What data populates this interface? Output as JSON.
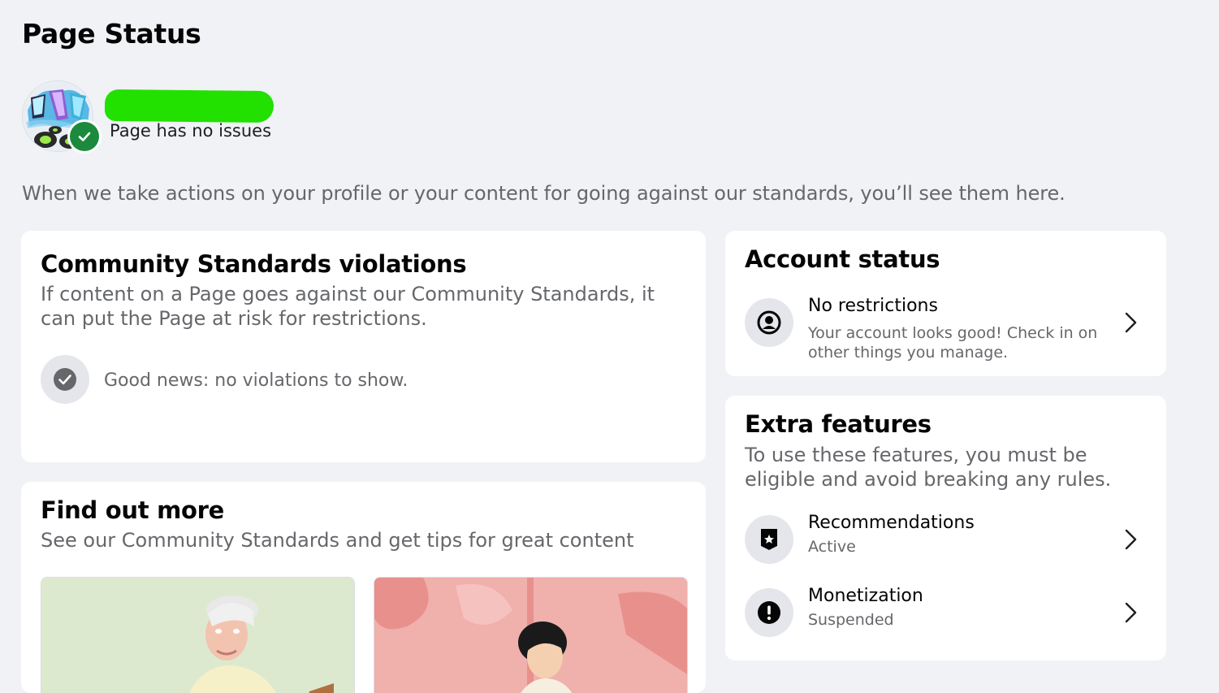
{
  "header": {
    "title": "Page Status"
  },
  "profile": {
    "status_text": "Page has no issues"
  },
  "description": "When we take actions on your profile or your content for going against our standards, you’ll see them here.",
  "community_standards": {
    "title": "Community Standards violations",
    "subtitle": "If content on a Page goes against our Community Standards, it can put the Page at risk for restrictions.",
    "good_news": "Good news: no violations to show."
  },
  "find_out_more": {
    "title": "Find out more",
    "subtitle": "See our Community Standards and get tips for great content"
  },
  "account_status": {
    "title": "Account status",
    "item": {
      "title": "No restrictions",
      "description": "Your account looks good! Check in on other things you manage."
    }
  },
  "extra_features": {
    "title": "Extra features",
    "subtitle": "To use these features, you must be eligible and avoid breaking any rules.",
    "items": [
      {
        "title": "Recommendations",
        "status": "Active",
        "icon": "badge-star-icon"
      },
      {
        "title": "Monetization",
        "status": "Suspended",
        "icon": "alert-icon"
      }
    ]
  },
  "colors": {
    "background": "#f0f2f5",
    "verified_green": "#1b8a3c",
    "redaction_green": "#22e000",
    "secondary_text": "#65676b"
  }
}
